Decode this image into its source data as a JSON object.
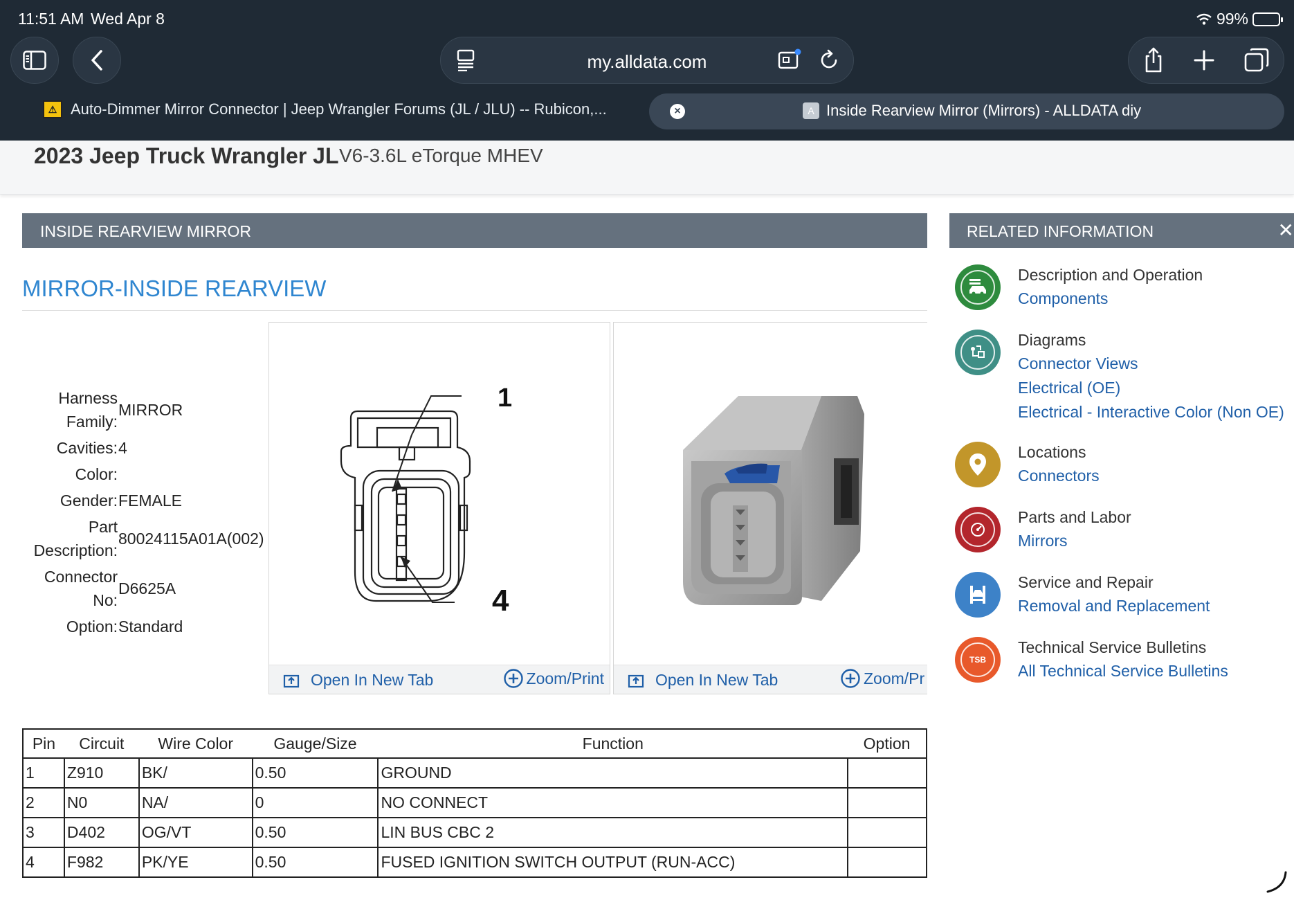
{
  "status_bar": {
    "time": "11:51 AM",
    "date": "Wed Apr 8",
    "battery": "99%"
  },
  "browser": {
    "url": "my.alldata.com",
    "tabs": [
      {
        "title": "Auto-Dimmer Mirror Connector | Jeep Wrangler Forums (JL / JLU) -- Rubicon,..."
      },
      {
        "title": "Inside Rearview Mirror (Mirrors) - ALLDATA diy",
        "favicon_letter": "A"
      }
    ]
  },
  "vehicle": {
    "model": "2023 Jeep Truck Wrangler JL",
    "engine": "V6-3.6L eTorque MHEV"
  },
  "panel": {
    "header": "INSIDE REARVIEW MIRROR",
    "title": "MIRROR-INSIDE REARVIEW",
    "specs": [
      {
        "label": "Harness Family:",
        "value": "MIRROR"
      },
      {
        "label": "Cavities:",
        "value": "4"
      },
      {
        "label": "Color:",
        "value": ""
      },
      {
        "label": "Gender:",
        "value": "FEMALE"
      },
      {
        "label": "Part Description:",
        "value": "80024115A01A(002)"
      },
      {
        "label": "Connector No:",
        "value": "D6625A"
      },
      {
        "label": "Option:",
        "value": "Standard"
      }
    ],
    "image_cards": [
      {
        "open_label": "Open In New Tab",
        "zoom_label": "Zoom/Print",
        "callout_top": "1",
        "callout_bottom": "4"
      },
      {
        "open_label": "Open In New Tab",
        "zoom_label": "Zoom/Pr"
      }
    ]
  },
  "pin_table": {
    "headers": [
      "Pin",
      "Circuit",
      "Wire Color",
      "Gauge/Size",
      "Function",
      "Option"
    ],
    "rows": [
      [
        "1",
        "Z910",
        "BK/",
        "0.50",
        "GROUND",
        ""
      ],
      [
        "2",
        "N0",
        "NA/",
        "0",
        "NO CONNECT",
        ""
      ],
      [
        "3",
        "D402",
        "OG/VT",
        "0.50",
        "LIN BUS CBC 2",
        ""
      ],
      [
        "4",
        "F982",
        "PK/YE",
        "0.50",
        "FUSED IGNITION SWITCH OUTPUT (RUN-ACC)",
        ""
      ]
    ]
  },
  "related": {
    "header": "RELATED INFORMATION",
    "close_glyph": "✕",
    "items": [
      {
        "title": "Description and Operation",
        "links": [
          "Components"
        ],
        "color": "#2e8b3e"
      },
      {
        "title": "Diagrams",
        "links": [
          "Connector Views",
          "Electrical (OE)",
          "Electrical - Interactive Color (Non OE)"
        ],
        "color": "#3f8f86"
      },
      {
        "title": "Locations",
        "links": [
          "Connectors"
        ],
        "color": "#c2962a"
      },
      {
        "title": "Parts and Labor",
        "links": [
          "Mirrors"
        ],
        "color": "#b3262c"
      },
      {
        "title": "Service and Repair",
        "links": [
          "Removal and Replacement"
        ],
        "color": "#3d82c8"
      },
      {
        "title": "Technical Service Bulletins",
        "links": [
          "All Technical Service Bulletins"
        ],
        "color": "#e8592b",
        "badge": "TSB"
      }
    ]
  }
}
